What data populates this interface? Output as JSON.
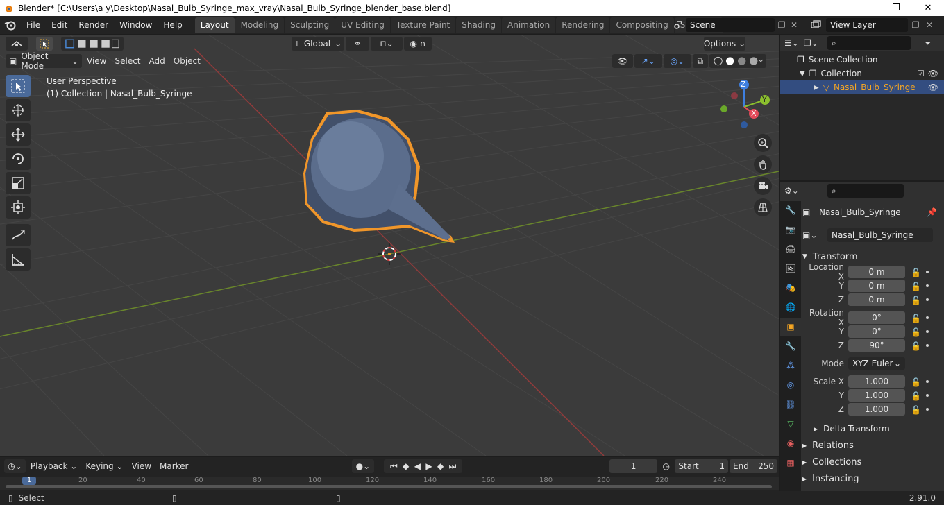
{
  "window": {
    "title": "Blender* [C:\\Users\\a y\\Desktop\\Nasal_Bulb_Syringe_max_vray\\Nasal_Bulb_Syringe_blender_base.blend]",
    "minimize": "—",
    "maximize": "❐",
    "close": "✕"
  },
  "menu": {
    "items": [
      "File",
      "Edit",
      "Render",
      "Window",
      "Help"
    ]
  },
  "workspaces": {
    "tabs": [
      "Layout",
      "Modeling",
      "Sculpting",
      "UV Editing",
      "Texture Paint",
      "Shading",
      "Animation",
      "Rendering",
      "Compositing",
      "Scripting"
    ],
    "active": "Layout",
    "plus": "+"
  },
  "scene": {
    "name": "Scene"
  },
  "view_layer": {
    "name": "View Layer"
  },
  "viewport": {
    "transform_orientation": "Global",
    "options_label": "Options",
    "mode": "Object Mode",
    "header_menus": [
      "View",
      "Select",
      "Add",
      "Object"
    ],
    "info_line1": "User Perspective",
    "info_line2": "(1) Collection | Nasal_Bulb_Syringe",
    "gizmo_labels": {
      "x": "X",
      "y": "Y",
      "z": "Z"
    }
  },
  "outliner": {
    "scene_collection": "Scene Collection",
    "collection": "Collection",
    "object": "Nasal_Bulb_Syringe"
  },
  "properties": {
    "object_name": "Nasal_Bulb_Syringe",
    "datablock_name": "Nasal_Bulb_Syringe",
    "transform_label": "Transform",
    "location": {
      "label": "Location X",
      "x": "0 m",
      "y": "0 m",
      "z": "0 m"
    },
    "rotation": {
      "label": "Rotation X",
      "x": "0°",
      "y": "0°",
      "z": "90°"
    },
    "mode_label": "Mode",
    "mode_value": "XYZ Euler",
    "scale": {
      "label": "Scale X",
      "x": "1.000",
      "y": "1.000",
      "z": "1.000"
    },
    "axis_y": "Y",
    "axis_z": "Z",
    "delta_transform": "Delta Transform",
    "relations": "Relations",
    "collections": "Collections",
    "instancing": "Instancing"
  },
  "timeline": {
    "menus": [
      "Playback",
      "Keying",
      "View",
      "Marker"
    ],
    "current_frame": "1",
    "start_label": "Start",
    "start_value": "1",
    "end_label": "End",
    "end_value": "250",
    "ruler_ticks": [
      "1",
      "20",
      "40",
      "60",
      "80",
      "100",
      "120",
      "140",
      "160",
      "180",
      "200",
      "220",
      "240"
    ]
  },
  "status": {
    "left": "Select",
    "version": "2.91.0"
  },
  "colors": {
    "accent_blue": "#4a6a9a",
    "selection_orange": "#f5a623",
    "x_axis": "#e34a5a",
    "y_axis": "#8bbf2e",
    "z_axis": "#3e7fe0"
  }
}
